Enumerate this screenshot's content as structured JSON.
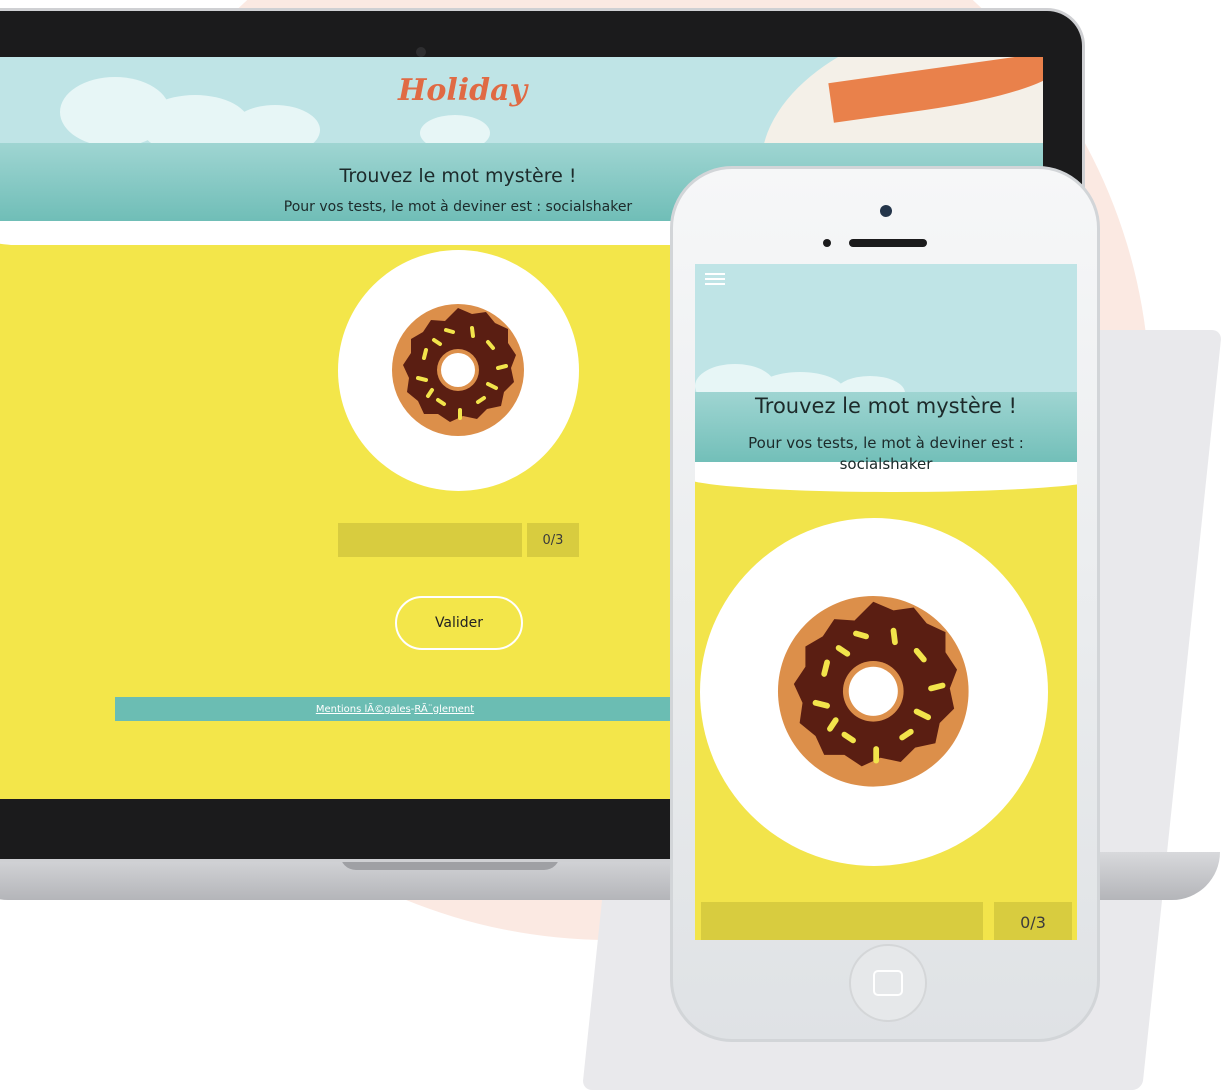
{
  "desktop": {
    "logo": "Holiday",
    "title": "Trouvez le mot mystère !",
    "subtitle": "Pour vos tests, le mot à deviner est : socialshaker",
    "counter": "0/3",
    "submit_label": "Valider",
    "footer": {
      "legal_link": "Mentions lÃ©gales",
      "separator": " - ",
      "rules_link": "RÃ¨glement"
    }
  },
  "mobile": {
    "title": "Trouvez le mot mystère !",
    "subtitle_line1": "Pour vos tests, le mot à deviner est :",
    "subtitle_line2": "socialshaker",
    "counter": "0/3",
    "menu_icon": "hamburger-icon"
  },
  "colors": {
    "sky": "#bfe4e6",
    "sea": "#6cbcb5",
    "sand": "#f3e64a",
    "logo": "#e06a44",
    "donut_icing": "#5a1e12",
    "donut_dough": "#dc8f4a"
  },
  "illustration": "donut-icon"
}
